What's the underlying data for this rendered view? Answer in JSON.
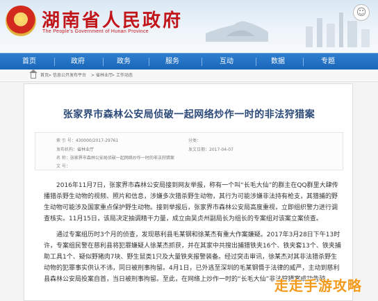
{
  "site": {
    "title": "湖南省人民政府",
    "subtitle": "The People's Government of Hunan Province",
    "emblem_glyph": "★",
    "search_glyph": "☺"
  },
  "nav": [
    "首页",
    "政府",
    "政务",
    "服务",
    "互动",
    "数据",
    "专题"
  ],
  "breadcrumb": [
    "首页",
    "信息公开发布平台",
    "省林业厅",
    "工作动态"
  ],
  "article": {
    "title": "张家界市森林公安局侦破一起网络炒作一时的非法狩猎案",
    "meta": {
      "index_label": "索 引 号：",
      "index_value": "430000/2017-29761",
      "category_label": "分类：",
      "category_value": "",
      "publisher_label": "发布机构：",
      "publisher_value": "省林业厅",
      "date_label": "发文日期：",
      "date_value": "2017-04-07",
      "name_label": "名 称：",
      "name_value": "张家界市森林公安局侦破一起网络炒作一时的非法狩猎案",
      "doc_label": "文 号：",
      "doc_value": ""
    },
    "paragraphs": [
      "2016年11月7日，张家界市森林公安局接到网友举报，称有一个叫“长毛大仙”的群主在QQ群里大肆传播猎杀野生动物的视频、照片和信息，涉嫌多次猎杀野生动物，其行为可能涉嫌非法持有枪支，其猎捕的野生动物可能涉及国家重点保护野生动物。接到举报后，张家界市森林公安局高度重视，立即组织警力进行调查核实。11月15日，该局决定抽调精干力量，成立由吴贞州副局长为组长的专案组对该案立案侦查。",
      "通过专案组历时3个月的侦查，发现慈利县毛某钢和徐某杰有重大作案嫌疑。2017年3月28日下午13时许，专案组民警在慈利县将犯罪嫌疑人徐某杰抓获，并在其家中共搜出捕猎铁夹16个、铁夹套13个、铁夹捕助工具1个、疑似野猪肉7块、野生鼠类1只及大量铁夹报警装备。经过突击审讯，徐某杰对其非法猎杀野生动物的犯罪事实供认不讳，同日被刑事拘留。4月1日，已外逃至深圳的毛某钢慑于法律的威严，主动到慈利县森林公安局投案自首，当日被刑事拘留。至此，在网络上炒作一时的“长毛大仙”非法狩猎案成功告破。"
    ]
  },
  "watermark": "走走手游攻略"
}
